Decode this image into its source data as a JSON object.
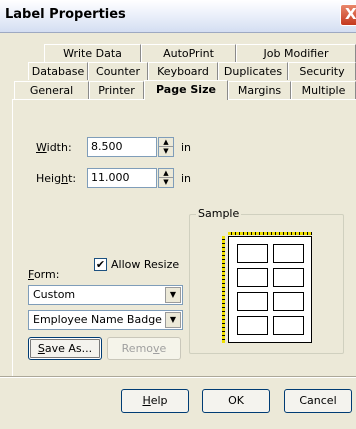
{
  "window": {
    "title": "Label Properties",
    "close_glyph": "X"
  },
  "tabs": {
    "row1": [
      "Write Data",
      "AutoPrint",
      "Job Modifier"
    ],
    "row2": [
      "Database",
      "Counter",
      "Keyboard",
      "Duplicates",
      "Security"
    ],
    "row3": [
      "General",
      "Printer",
      "Page Size",
      "Margins",
      "Multiple"
    ],
    "active": "Page Size"
  },
  "page_size": {
    "width_label_mnemonic": "W",
    "width_label_rest": "idth:",
    "width_value": "8.500",
    "width_unit": "in",
    "height_label_pre": "Heig",
    "height_label_mnemonic": "h",
    "height_label_rest": "t:",
    "height_value": "11.000",
    "height_unit": "in",
    "spin_up": "▲",
    "spin_down": "▼"
  },
  "form": {
    "allow_resize_label": "Allow Resize",
    "allow_resize_checked": "✔",
    "form_label_mnemonic": "F",
    "form_label_rest": "orm:",
    "form_value": "Custom",
    "name_value": "Employee Name Badge",
    "dropdown_arrow": "▼",
    "save_as_mnemonic": "S",
    "save_as_rest": "ave As...",
    "remove_pre": "Remo",
    "remove_mnemonic": "v",
    "remove_rest": "e"
  },
  "sample": {
    "title": "Sample"
  },
  "footer": {
    "help_mnemonic": "H",
    "help_rest": "elp",
    "ok_label": "OK",
    "cancel_label": "Cancel"
  },
  "colors": {
    "accent": "#003c74",
    "ruler": "#f0e000",
    "close": "#c4391e"
  }
}
